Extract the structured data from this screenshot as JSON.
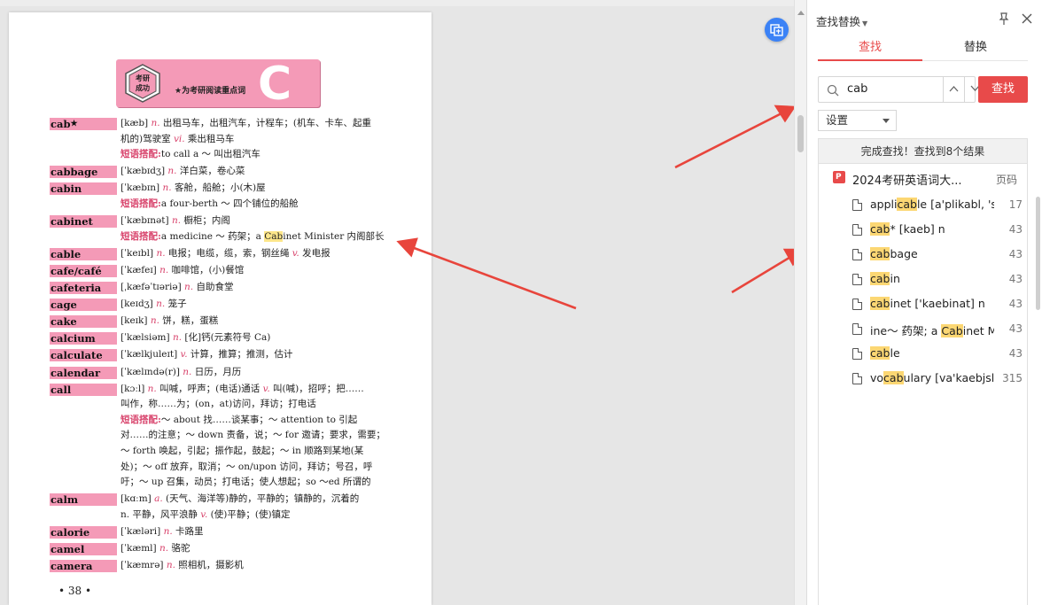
{
  "document": {
    "banner": {
      "badge_text": "考研成功",
      "subtitle": "★为考研阅读重点词",
      "letter": "C"
    },
    "phrase_label": "短语搭配",
    "entries": [
      {
        "word": "cab",
        "star": "★",
        "lines": [
          "[kæb] n. 出租马车，出租汽车，计程车；(机车、卡车、起重",
          "机的)驾驶室 vi. 乘出租马车",
          "短语搭配:to call a ～ 叫出租汽车"
        ]
      },
      {
        "word": "cabbage",
        "lines": [
          "[ˈkæbɪdʒ] n. 洋白菜，卷心菜"
        ]
      },
      {
        "word": "cabin",
        "lines": [
          "[ˈkæbɪn] n. 客舱，船舱；小(木)屋",
          "短语搭配:a four-berth ～ 四个铺位的船舱"
        ]
      },
      {
        "word": "cabinet",
        "lines": [
          "[ˈkæbɪnət] n. 橱柜；内阁",
          "短语搭配:a medicine ～ 药架；a Cabinet Minister 内阁部长"
        ]
      },
      {
        "word": "cable",
        "lines": [
          "[ˈkeɪbl] n. 电报；电缆，缆，索，钢丝绳 v. 发电报"
        ]
      },
      {
        "word": "cafe/café",
        "lines": [
          "[ˈkæfeɪ] n. 咖啡馆，(小)餐馆"
        ]
      },
      {
        "word": "cafeteria",
        "lines": [
          "[ˌkæfəˈtɪəriə] n. 自助食堂"
        ]
      },
      {
        "word": "cage",
        "lines": [
          "[keɪdʒ] n. 笼子"
        ]
      },
      {
        "word": "cake",
        "lines": [
          "[keɪk] n. 饼，糕，蛋糕"
        ]
      },
      {
        "word": "calcium",
        "lines": [
          "[ˈkælsiəm] n. [化]钙(元素符号 Ca)"
        ]
      },
      {
        "word": "calculate",
        "lines": [
          "[ˈkælkjuleɪt] v. 计算，推算；推测，估计"
        ]
      },
      {
        "word": "calendar",
        "lines": [
          "[ˈkælɪndə(r)] n. 日历，月历"
        ]
      },
      {
        "word": "call",
        "lines": [
          "[kɔːl] n. 叫喊，呼声；(电话)通话 v. 叫(喊)，招呼；把……",
          "叫作，称……为；(on，at)访问，拜访；打电话",
          "短语搭配:～ about 找……谈某事；～ attention to 引起",
          "对……的注意；～ down 责备，说；～ for 邀请；要求，需要；",
          "～ forth 唤起，引起；振作起，鼓起；～ in 顺路到某地(某",
          "处)；～ off 放弃，取消；～ on/upon 访问，拜访；号召，呼",
          "吁；～ up 召集，动员；打电话；使人想起；so ～ed 所谓的"
        ]
      },
      {
        "word": "calm",
        "lines": [
          "[kɑːm] a. (天气、海洋等)静的，平静的；镇静的，沉着的",
          "n. 平静，风平浪静 v. (使)平静；(使)镇定"
        ]
      },
      {
        "word": "calorie",
        "lines": [
          "[ˈkæləri] n. 卡路里"
        ]
      },
      {
        "word": "camel",
        "lines": [
          "[ˈkæml] n. 骆驼"
        ]
      },
      {
        "word": "camera",
        "lines": [
          "[ˈkæmrə] n. 照相机，摄影机"
        ]
      }
    ],
    "page_number": "• 38 •"
  },
  "panel": {
    "title": "查找替换",
    "tabs": {
      "find": "查找",
      "replace": "替换"
    },
    "search": {
      "value": "cab",
      "placeholder": ""
    },
    "find_button": "查找",
    "settings_label": "设置",
    "status": "完成查找！查找到8个结果",
    "file": {
      "name": "2024考研英语词大...",
      "page_col": "页码"
    },
    "results": [
      {
        "pre": "appli",
        "match": "cab",
        "post": "le [a'plikabl, 'se",
        "page": "17"
      },
      {
        "pre": "",
        "match": "cab",
        "post": "* [kaeb] n",
        "page": "43"
      },
      {
        "pre": "",
        "match": "cab",
        "post": "bage",
        "page": "43"
      },
      {
        "pre": "",
        "match": "cab",
        "post": "in",
        "page": "43"
      },
      {
        "pre": "",
        "match": "cab",
        "post": "inet ['kaebinat] n",
        "page": "43"
      },
      {
        "pre": "ine～ 药架; a ",
        "match": "Cab",
        "post": "inet M",
        "page": "43"
      },
      {
        "pre": "",
        "match": "cab",
        "post": "le",
        "page": "43"
      },
      {
        "pre": "vo",
        "match": "cab",
        "post": "ulary [va'kaebjslar",
        "page": "315"
      }
    ]
  },
  "colors": {
    "accent": "#e84a4a",
    "headword_bg": "#f49ab7",
    "highlight": "#fcd773",
    "annotation_arrow": "#e8453c"
  }
}
